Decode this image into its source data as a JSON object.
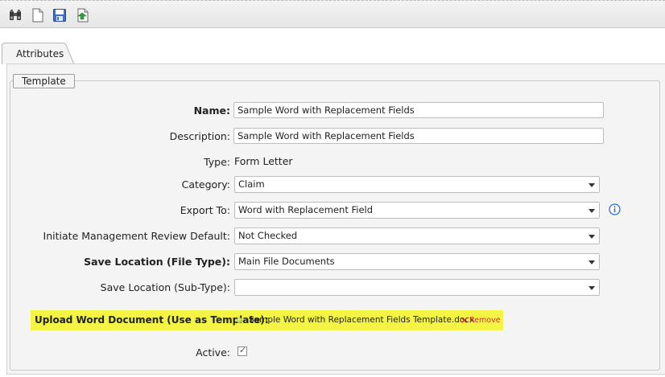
{
  "toolbar": {
    "buttons": [
      {
        "name": "binoculars-icon"
      },
      {
        "name": "new-document-icon"
      },
      {
        "name": "save-icon"
      },
      {
        "name": "export-icon"
      }
    ]
  },
  "tabs": [
    {
      "label": "Attributes",
      "active": true
    }
  ],
  "group": {
    "legend": "Template"
  },
  "form": {
    "name": {
      "label": "Name:",
      "value": "Sample Word with Replacement Fields"
    },
    "description": {
      "label": "Description:",
      "value": "Sample Word with Replacement Fields"
    },
    "type": {
      "label": "Type:",
      "value": "Form Letter"
    },
    "category": {
      "label": "Category:",
      "value": "Claim"
    },
    "export_to": {
      "label": "Export To:",
      "value": "Word with Replacement Field"
    },
    "mgmt_review": {
      "label": "Initiate Management Review Default:",
      "value": "Not Checked"
    },
    "save_location_file": {
      "label": "Save Location (File Type):",
      "value": "Main File Documents"
    },
    "save_location_sub": {
      "label": "Save Location (Sub-Type):",
      "value": ""
    },
    "upload": {
      "label": "Upload Word Document (Use as Template):",
      "file": "Sample Word with Replacement Fields Template.docx",
      "remove_x": "×",
      "remove_label": "Remove"
    },
    "active": {
      "label": "Active:",
      "checked": true,
      "check_glyph": "✓"
    }
  },
  "colors": {
    "highlight": "#f4f444",
    "info": "#2a6cd6"
  }
}
